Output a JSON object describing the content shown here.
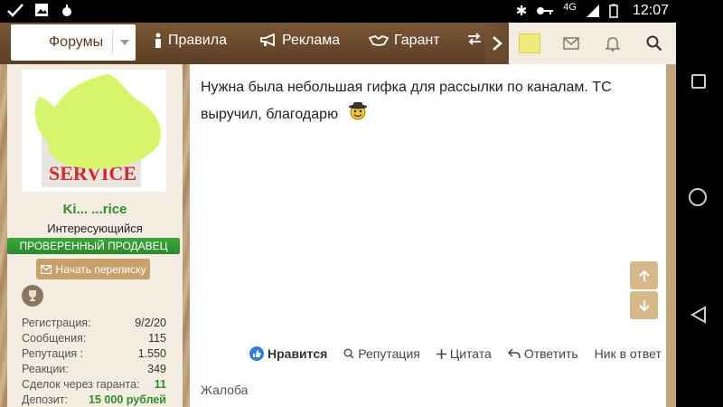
{
  "status_bar": {
    "network": "4G",
    "time": "12:07"
  },
  "top_menu": {
    "forums": "Форумы",
    "rules": "Правила",
    "ads": "Реклама",
    "guarantor": "Гарант"
  },
  "user": {
    "name": "Ki... ...rice",
    "title": "Интересующийся",
    "badge": "ПРОВЕРЕННЫЙ ПРОДАВЕЦ",
    "start_conversation": "Начать переписку",
    "stats": [
      {
        "label": "Регистрация:",
        "value": "9/2/20"
      },
      {
        "label": "Сообщения:",
        "value": "115"
      },
      {
        "label": "Репутация :",
        "value": "1.550"
      },
      {
        "label": "Реакции:",
        "value": "349"
      },
      {
        "label": "Сделок через гаранта:",
        "value": "11"
      },
      {
        "label": "Депозит:",
        "value": "15 000 рублей"
      }
    ]
  },
  "post": {
    "text": "Нужна была небольшая гифка для рассылки по каналам. ТС выручил, благодарю",
    "actions": {
      "like": "Нравится",
      "reputation": "Репутация",
      "quote": "Цитата",
      "reply": "Ответить",
      "nick": "Ник в ответ"
    },
    "report": "Жалоба"
  },
  "colors": {
    "nav_brown": "#6a4a2c",
    "verified_green": "#2f8e2f",
    "button_tan": "#c7a06a"
  }
}
